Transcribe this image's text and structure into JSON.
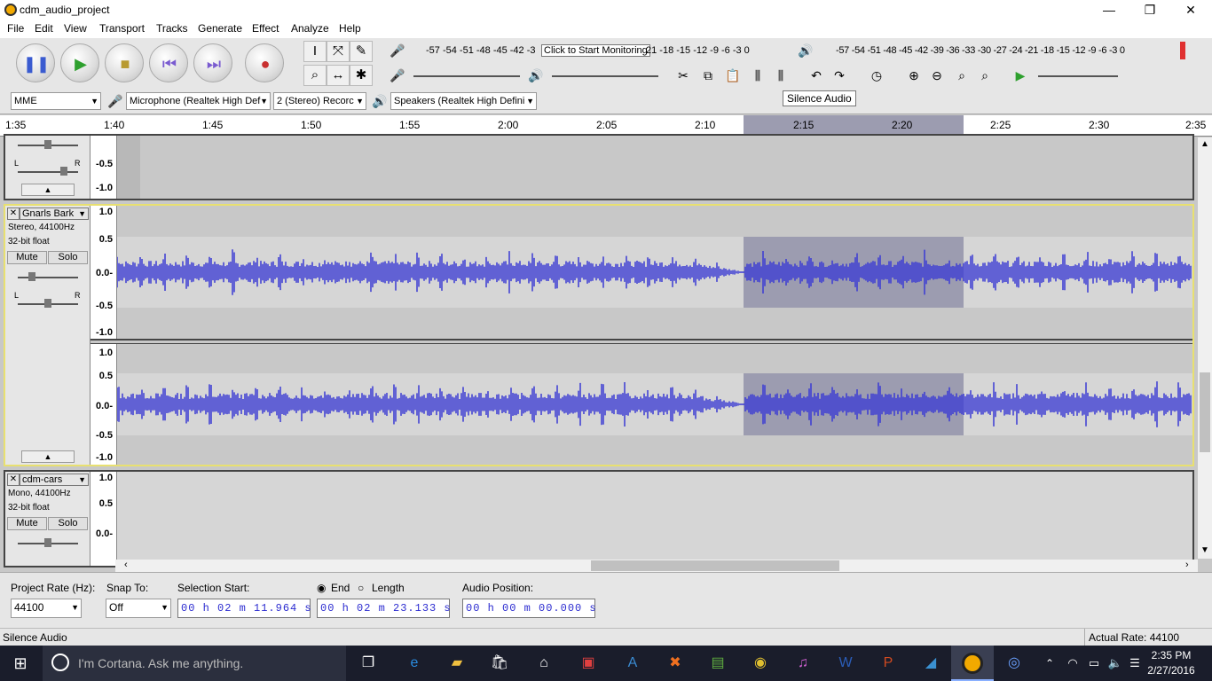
{
  "window": {
    "title": "cdm_audio_project",
    "minimize": "—",
    "restore": "❐",
    "close": "✕"
  },
  "menus": [
    "File",
    "Edit",
    "View",
    "Transport",
    "Tracks",
    "Generate",
    "Effect",
    "Analyze",
    "Help"
  ],
  "record_meter": {
    "scale": "-57 -54 -51 -48 -45 -42 -3",
    "monitor_tooltip": "Click to Start Monitoring",
    "scale_right": "21 -18 -15 -12 -9 -6 -3 0"
  },
  "playback_meter": {
    "scale": "-57 -54 -51 -48 -45 -42 -39 -36 -33 -30 -27 -24 -21 -18 -15 -12 -9 -6 -3 0"
  },
  "tooltip": "Silence Audio",
  "devices": {
    "host": "MME",
    "mic": "Microphone (Realtek High Def",
    "channels": "2 (Stereo) Recorc",
    "speakers": "Speakers (Realtek High Defini"
  },
  "ruler": [
    "1:35",
    "1:40",
    "1:45",
    "1:50",
    "1:55",
    "2:00",
    "2:05",
    "2:10",
    "2:15",
    "2:20",
    "2:25",
    "2:30",
    "2:35"
  ],
  "tracks": {
    "top": {
      "scales": [
        "-0.5",
        "-1.0"
      ],
      "pan_l": "L",
      "pan_r": "R"
    },
    "gnarls": {
      "close": "✕",
      "name": "Gnarls Bark",
      "info1": "Stereo, 44100Hz",
      "info2": "32-bit float",
      "mute": "Mute",
      "solo": "Solo",
      "pan_l": "L",
      "pan_r": "R",
      "scales_top": [
        "1.0",
        "0.5",
        "0.0-",
        "-0.5",
        "-1.0"
      ],
      "scales_bottom": [
        "1.0",
        "0.5",
        "0.0-",
        "-0.5",
        "-1.0"
      ]
    },
    "cars": {
      "close": "✕",
      "name": "cdm-cars",
      "info1": "Mono, 44100Hz",
      "info2": "32-bit float",
      "mute": "Mute",
      "solo": "Solo",
      "scales": [
        "1.0",
        "0.5",
        "0.0-"
      ]
    }
  },
  "bottom": {
    "rate_label": "Project Rate (Hz):",
    "rate_value": "44100",
    "snap_label": "Snap To:",
    "snap_value": "Off",
    "sel_start_label": "Selection Start:",
    "sel_start_value": "00 h 02 m 11.964 s",
    "end_label": "End",
    "length_label": "Length",
    "end_value": "00 h 02 m 23.133 s",
    "audio_pos_label": "Audio Position:",
    "audio_pos_value": "00 h 00 m 00.000 s"
  },
  "status": {
    "left": "Silence Audio",
    "right": "Actual Rate: 44100"
  },
  "taskbar": {
    "search": "I'm Cortana. Ask me anything.",
    "time": "2:35 PM",
    "date": "2/27/2016"
  },
  "colors": {
    "wave": "#3a3ad4",
    "selection": "#9c9cb0",
    "track_border_selected": "#e8e070"
  }
}
